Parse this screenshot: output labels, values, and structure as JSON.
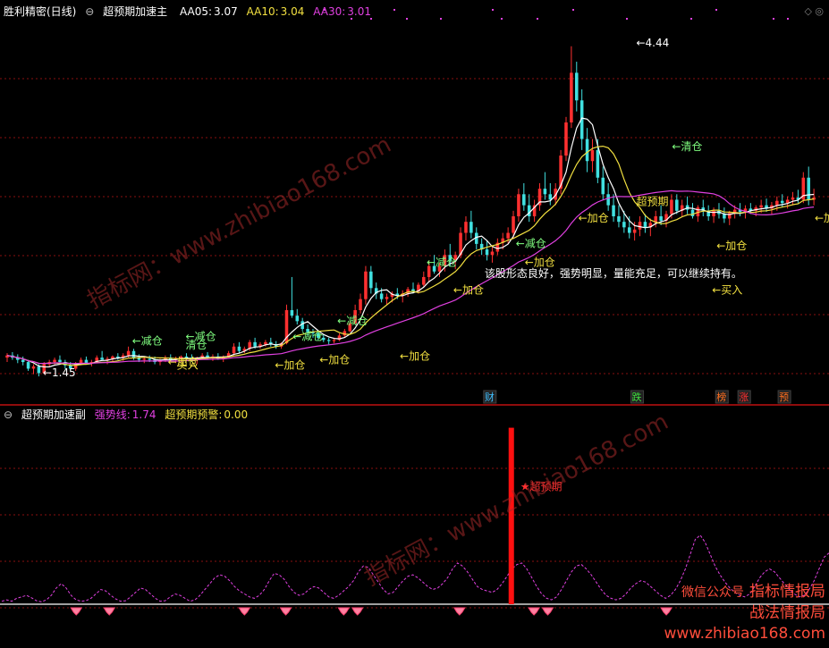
{
  "main_header": {
    "stock": "胜利精密(日线)",
    "indicator": "超预期加速主",
    "aa05_label": "AA05:",
    "aa05_value": "3.07",
    "aa10_label": "AA10:",
    "aa10_value": "3.04",
    "aa30_label": "AA30:",
    "aa30_value": "3.01"
  },
  "sub_header": {
    "indicator": "超预期加速副",
    "strength_label": "强势线:",
    "strength_value": "1.74",
    "warning_label": "超预期预警:",
    "warning_value": "0.00"
  },
  "colors": {
    "up": "#ff3030",
    "down": "#40e0e0",
    "ma5": "#ffffff",
    "ma10": "#f2e040",
    "ma30": "#e040e0",
    "signal": "#ffffff",
    "warn_bar": "#ff1010",
    "grid": "#8a1010"
  },
  "watermarks": [
    "指标网：www.zhibiao168.com",
    "指标网：www.zhibiao168.com"
  ],
  "corner_text": [
    "指标情报局",
    "微信公众号",
    "战法情报局",
    "www.zhibiao168.com"
  ],
  "chart_data": {
    "type": "candlestick",
    "ylim": [
      1.2,
      4.6
    ],
    "n_bars": 155,
    "candles": [
      [
        1.62,
        1.66,
        1.58,
        1.64
      ],
      [
        1.64,
        1.67,
        1.6,
        1.62
      ],
      [
        1.62,
        1.65,
        1.57,
        1.6
      ],
      [
        1.6,
        1.63,
        1.55,
        1.58
      ],
      [
        1.58,
        1.6,
        1.5,
        1.52
      ],
      [
        1.52,
        1.56,
        1.47,
        1.54
      ],
      [
        1.54,
        1.56,
        1.45,
        1.48
      ],
      [
        1.48,
        1.58,
        1.47,
        1.56
      ],
      [
        1.56,
        1.6,
        1.54,
        1.58
      ],
      [
        1.58,
        1.62,
        1.55,
        1.6
      ],
      [
        1.6,
        1.64,
        1.56,
        1.58
      ],
      [
        1.58,
        1.6,
        1.52,
        1.55
      ],
      [
        1.55,
        1.58,
        1.5,
        1.52
      ],
      [
        1.52,
        1.58,
        1.5,
        1.56
      ],
      [
        1.56,
        1.62,
        1.55,
        1.6
      ],
      [
        1.6,
        1.63,
        1.56,
        1.57
      ],
      [
        1.57,
        1.6,
        1.54,
        1.58
      ],
      [
        1.58,
        1.64,
        1.57,
        1.62
      ],
      [
        1.62,
        1.68,
        1.6,
        1.6
      ],
      [
        1.6,
        1.63,
        1.56,
        1.61
      ],
      [
        1.61,
        1.64,
        1.58,
        1.63
      ],
      [
        1.63,
        1.66,
        1.6,
        1.62
      ],
      [
        1.62,
        1.66,
        1.59,
        1.64
      ],
      [
        1.64,
        1.72,
        1.62,
        1.68
      ],
      [
        1.68,
        1.7,
        1.6,
        1.62
      ],
      [
        1.62,
        1.65,
        1.58,
        1.6
      ],
      [
        1.6,
        1.63,
        1.57,
        1.61
      ],
      [
        1.61,
        1.64,
        1.58,
        1.6
      ],
      [
        1.6,
        1.63,
        1.56,
        1.58
      ],
      [
        1.58,
        1.61,
        1.55,
        1.6
      ],
      [
        1.6,
        1.64,
        1.58,
        1.62
      ],
      [
        1.62,
        1.65,
        1.59,
        1.6
      ],
      [
        1.6,
        1.63,
        1.57,
        1.61
      ],
      [
        1.61,
        1.64,
        1.58,
        1.63
      ],
      [
        1.63,
        1.66,
        1.6,
        1.62
      ],
      [
        1.62,
        1.65,
        1.58,
        1.6
      ],
      [
        1.6,
        1.63,
        1.56,
        1.62
      ],
      [
        1.62,
        1.66,
        1.6,
        1.64
      ],
      [
        1.64,
        1.67,
        1.61,
        1.62
      ],
      [
        1.62,
        1.65,
        1.59,
        1.63
      ],
      [
        1.63,
        1.66,
        1.6,
        1.61
      ],
      [
        1.61,
        1.64,
        1.58,
        1.63
      ],
      [
        1.63,
        1.68,
        1.62,
        1.66
      ],
      [
        1.66,
        1.75,
        1.64,
        1.72
      ],
      [
        1.72,
        1.76,
        1.66,
        1.68
      ],
      [
        1.68,
        1.72,
        1.66,
        1.7
      ],
      [
        1.7,
        1.78,
        1.68,
        1.76
      ],
      [
        1.76,
        1.8,
        1.7,
        1.72
      ],
      [
        1.72,
        1.76,
        1.7,
        1.74
      ],
      [
        1.74,
        1.78,
        1.72,
        1.76
      ],
      [
        1.76,
        1.8,
        1.72,
        1.74
      ],
      [
        1.74,
        1.77,
        1.7,
        1.72
      ],
      [
        1.72,
        1.76,
        1.7,
        1.75
      ],
      [
        1.75,
        2.1,
        1.74,
        2.05
      ],
      [
        2.05,
        2.35,
        1.98,
        2.0
      ],
      [
        2.0,
        2.06,
        1.92,
        1.95
      ],
      [
        1.95,
        1.98,
        1.86,
        1.88
      ],
      [
        1.88,
        1.92,
        1.82,
        1.85
      ],
      [
        1.85,
        1.88,
        1.8,
        1.84
      ],
      [
        1.84,
        1.86,
        1.78,
        1.8
      ],
      [
        1.8,
        1.83,
        1.76,
        1.78
      ],
      [
        1.78,
        1.8,
        1.74,
        1.77
      ],
      [
        1.77,
        1.8,
        1.75,
        1.78
      ],
      [
        1.78,
        1.84,
        1.77,
        1.82
      ],
      [
        1.82,
        1.88,
        1.8,
        1.86
      ],
      [
        1.86,
        1.95,
        1.85,
        1.93
      ],
      [
        1.93,
        2.1,
        1.92,
        2.05
      ],
      [
        2.05,
        2.2,
        2.02,
        2.15
      ],
      [
        2.15,
        2.45,
        2.1,
        2.4
      ],
      [
        2.4,
        2.45,
        2.2,
        2.25
      ],
      [
        2.25,
        2.3,
        2.15,
        2.2
      ],
      [
        2.2,
        2.25,
        2.12,
        2.15
      ],
      [
        2.15,
        2.2,
        2.1,
        2.17
      ],
      [
        2.17,
        2.22,
        2.12,
        2.2
      ],
      [
        2.2,
        2.25,
        2.15,
        2.18
      ],
      [
        2.18,
        2.23,
        2.12,
        2.2
      ],
      [
        2.2,
        2.26,
        2.17,
        2.24
      ],
      [
        2.24,
        2.3,
        2.2,
        2.22
      ],
      [
        2.22,
        2.3,
        2.2,
        2.28
      ],
      [
        2.28,
        2.4,
        2.26,
        2.35
      ],
      [
        2.35,
        2.5,
        2.3,
        2.45
      ],
      [
        2.45,
        2.55,
        2.38,
        2.4
      ],
      [
        2.4,
        2.48,
        2.35,
        2.45
      ],
      [
        2.45,
        2.6,
        2.4,
        2.55
      ],
      [
        2.55,
        2.65,
        2.45,
        2.5
      ],
      [
        2.5,
        2.58,
        2.42,
        2.55
      ],
      [
        2.55,
        2.8,
        2.52,
        2.75
      ],
      [
        2.75,
        2.9,
        2.68,
        2.85
      ],
      [
        2.85,
        2.95,
        2.7,
        2.75
      ],
      [
        2.75,
        2.8,
        2.6,
        2.65
      ],
      [
        2.65,
        2.7,
        2.55,
        2.6
      ],
      [
        2.6,
        2.68,
        2.5,
        2.55
      ],
      [
        2.55,
        2.62,
        2.48,
        2.58
      ],
      [
        2.58,
        2.7,
        2.55,
        2.66
      ],
      [
        2.66,
        2.75,
        2.6,
        2.7
      ],
      [
        2.7,
        2.8,
        2.65,
        2.75
      ],
      [
        2.75,
        2.95,
        2.7,
        2.9
      ],
      [
        2.9,
        3.15,
        2.85,
        3.1
      ],
      [
        3.1,
        3.2,
        2.95,
        3.0
      ],
      [
        3.0,
        3.1,
        2.85,
        2.9
      ],
      [
        2.9,
        3.05,
        2.85,
        3.0
      ],
      [
        3.0,
        3.2,
        2.95,
        3.15
      ],
      [
        3.15,
        3.3,
        3.05,
        3.1
      ],
      [
        3.1,
        3.2,
        3.0,
        3.05
      ],
      [
        3.05,
        3.2,
        3.0,
        3.15
      ],
      [
        3.15,
        3.5,
        3.1,
        3.45
      ],
      [
        3.45,
        3.8,
        3.4,
        3.75
      ],
      [
        3.75,
        4.44,
        3.7,
        4.2
      ],
      [
        4.2,
        4.3,
        3.85,
        3.95
      ],
      [
        3.95,
        4.05,
        3.5,
        3.6
      ],
      [
        3.6,
        3.7,
        3.3,
        3.4
      ],
      [
        3.4,
        3.6,
        3.3,
        3.5
      ],
      [
        3.5,
        3.6,
        3.2,
        3.25
      ],
      [
        3.25,
        3.35,
        3.05,
        3.1
      ],
      [
        3.1,
        3.2,
        2.95,
        3.0
      ],
      [
        3.0,
        3.1,
        2.85,
        2.9
      ],
      [
        2.9,
        3.0,
        2.8,
        2.85
      ],
      [
        2.85,
        2.95,
        2.75,
        2.8
      ],
      [
        2.8,
        2.9,
        2.7,
        2.75
      ],
      [
        2.75,
        2.85,
        2.68,
        2.78
      ],
      [
        2.78,
        2.9,
        2.72,
        2.85
      ],
      [
        2.85,
        2.92,
        2.75,
        2.8
      ],
      [
        2.8,
        2.88,
        2.72,
        2.84
      ],
      [
        2.84,
        2.95,
        2.8,
        2.9
      ],
      [
        2.9,
        3.0,
        2.82,
        2.86
      ],
      [
        2.86,
        2.95,
        2.8,
        2.92
      ],
      [
        2.92,
        3.1,
        2.88,
        3.05
      ],
      [
        3.05,
        3.1,
        2.92,
        2.95
      ],
      [
        2.95,
        3.05,
        2.9,
        3.0
      ],
      [
        3.0,
        3.08,
        2.92,
        2.96
      ],
      [
        2.96,
        3.02,
        2.88,
        2.9
      ],
      [
        2.9,
        3.0,
        2.85,
        2.98
      ],
      [
        2.98,
        3.05,
        2.9,
        2.95
      ],
      [
        2.95,
        3.0,
        2.86,
        2.9
      ],
      [
        2.9,
        2.98,
        2.84,
        2.95
      ],
      [
        2.95,
        3.02,
        2.88,
        2.92
      ],
      [
        2.92,
        2.98,
        2.84,
        2.88
      ],
      [
        2.88,
        2.95,
        2.82,
        2.93
      ],
      [
        2.93,
        3.0,
        2.88,
        2.96
      ],
      [
        2.96,
        3.02,
        2.9,
        2.94
      ],
      [
        2.94,
        3.0,
        2.88,
        2.97
      ],
      [
        2.97,
        3.02,
        2.92,
        2.95
      ],
      [
        2.95,
        3.0,
        2.9,
        2.98
      ],
      [
        2.98,
        3.05,
        2.93,
        3.0
      ],
      [
        3.0,
        3.06,
        2.94,
        2.97
      ],
      [
        2.97,
        3.03,
        2.92,
        3.0
      ],
      [
        3.0,
        3.08,
        2.95,
        3.04
      ],
      [
        3.04,
        3.1,
        2.98,
        3.02
      ],
      [
        3.02,
        3.08,
        2.97,
        3.05
      ],
      [
        3.05,
        3.12,
        3.0,
        3.07
      ],
      [
        3.07,
        3.14,
        3.02,
        3.05
      ],
      [
        3.05,
        3.3,
        3.02,
        3.25
      ],
      [
        3.25,
        3.35,
        3.0,
        3.05
      ],
      [
        3.05,
        3.15,
        3.0,
        3.07
      ]
    ],
    "ma5_label": "AA05",
    "ma10_label": "AA10",
    "ma30_label": "AA30",
    "annotations": [
      {
        "i": 8,
        "price": 1.45,
        "text": "←1.45",
        "color": "#ffffff"
      },
      {
        "i": 28,
        "price": 1.74,
        "text": "←减仓",
        "color": "#80ff80"
      },
      {
        "i": 40,
        "price": 1.78,
        "text": "←减仓",
        "color": "#80ff80"
      },
      {
        "i": 40,
        "price": 1.7,
        "text": "清仓",
        "color": "#80ff80"
      },
      {
        "i": 36,
        "price": 1.55,
        "text": "←加仓",
        "color": "#f2e040"
      },
      {
        "i": 38,
        "price": 1.52,
        "text": "买入",
        "color": "#f2e040"
      },
      {
        "i": 60,
        "price": 1.52,
        "text": "←加仓",
        "color": "#f2e040"
      },
      {
        "i": 64,
        "price": 1.78,
        "text": "←减仓",
        "color": "#80ff80"
      },
      {
        "i": 70,
        "price": 1.57,
        "text": "←加仓",
        "color": "#f2e040"
      },
      {
        "i": 74,
        "price": 1.92,
        "text": "←减仓",
        "color": "#80ff80"
      },
      {
        "i": 88,
        "price": 1.6,
        "text": "←加仓",
        "color": "#f2e040"
      },
      {
        "i": 94,
        "price": 2.45,
        "text": "←减仓",
        "color": "#80ff80"
      },
      {
        "i": 100,
        "price": 2.2,
        "text": "←加仓",
        "color": "#f2e040"
      },
      {
        "i": 114,
        "price": 2.62,
        "text": "←减仓",
        "color": "#80ff80"
      },
      {
        "i": 116,
        "price": 2.45,
        "text": "←加仓",
        "color": "#f2e040"
      },
      {
        "i": 128,
        "price": 2.85,
        "text": "←加仓",
        "color": "#f2e040"
      },
      {
        "i": 141,
        "price": 3.0,
        "text": "超预期",
        "color": "#f2e040"
      },
      {
        "i": 149,
        "price": 3.5,
        "text": "←清仓",
        "color": "#80ff80"
      },
      {
        "i": 159,
        "price": 2.6,
        "text": "←加仓",
        "color": "#f2e040"
      },
      {
        "i": 158,
        "price": 2.2,
        "text": "←买入",
        "color": "#f2e040"
      },
      {
        "i": 181,
        "price": 2.85,
        "text": "←加",
        "color": "#f2e040"
      },
      {
        "i": 141,
        "price": 4.44,
        "text": "←4.44",
        "color": "#ffffff"
      }
    ],
    "commentary": {
      "i": 107,
      "price": 2.35,
      "text": "该股形态良好，强势明显，量能充足，可以继续持有。",
      "color": "#ffffff"
    },
    "event_labels": [
      {
        "i": 108,
        "text": "财",
        "color": "#40c0ff"
      },
      {
        "i": 141,
        "text": "跌",
        "color": "#40e040"
      },
      {
        "i": 160,
        "text": "榜",
        "color": "#ff7020"
      },
      {
        "i": 165,
        "text": "涨",
        "color": "#ff3030"
      },
      {
        "i": 174,
        "text": "预",
        "color": "#ff7020"
      }
    ],
    "sub": {
      "type": "line",
      "strength_series": [
        0.1,
        0.15,
        0.1,
        0.2,
        0.25,
        0.3,
        0.22,
        0.12,
        0.08,
        0.15,
        0.3,
        0.55,
        0.7,
        0.55,
        0.3,
        0.15,
        0.1,
        0.12,
        0.2,
        0.35,
        0.5,
        0.45,
        0.3,
        0.18,
        0.1,
        0.12,
        0.25,
        0.4,
        0.55,
        0.5,
        0.35,
        0.2,
        0.1,
        0.12,
        0.25,
        0.35,
        0.3,
        0.2,
        0.1,
        0.15,
        0.3,
        0.5,
        0.7,
        0.9,
        1.0,
        0.95,
        0.8,
        0.6,
        0.45,
        0.35,
        0.25,
        0.2,
        0.3,
        0.5,
        0.8,
        1.05,
        1.0,
        0.85,
        0.6,
        0.4,
        0.3,
        0.35,
        0.5,
        0.6,
        0.55,
        0.4,
        0.25,
        0.2,
        0.3,
        0.45,
        0.6,
        0.8,
        1.1,
        1.3,
        1.25,
        1.0,
        0.75,
        0.5,
        0.35,
        0.4,
        0.6,
        0.8,
        0.95,
        1.0,
        0.9,
        0.75,
        0.6,
        0.5,
        0.55,
        0.7,
        0.9,
        1.2,
        1.4,
        1.3,
        1.1,
        0.85,
        0.6,
        0.5,
        0.45,
        0.4,
        0.5,
        0.7,
        0.95,
        1.2,
        1.35,
        1.4,
        1.2,
        0.9,
        0.6,
        0.35,
        0.2,
        0.15,
        0.25,
        0.5,
        0.8,
        1.1,
        1.3,
        1.35,
        1.2,
        1.0,
        0.75,
        0.5,
        0.3,
        0.2,
        0.15,
        0.2,
        0.35,
        0.55,
        0.7,
        0.8,
        0.75,
        0.6,
        0.45,
        0.3,
        0.2,
        0.3,
        0.5,
        0.8,
        1.2,
        1.7,
        2.2,
        2.35,
        2.1,
        1.7,
        1.3,
        1.0,
        0.75,
        0.55,
        0.4,
        0.3,
        0.25,
        0.35,
        0.6,
        0.9,
        1.1,
        1.2,
        1.1,
        0.9,
        0.7,
        0.5,
        0.35,
        0.25,
        0.3,
        0.5,
        0.8,
        1.2,
        1.6,
        1.74
      ],
      "warning_index": 113,
      "warning_value": 6.0,
      "warning_label": "★超预期",
      "diamond_indices": [
        27,
        39,
        88,
        103,
        124,
        129,
        166,
        193,
        198,
        241
      ]
    }
  }
}
